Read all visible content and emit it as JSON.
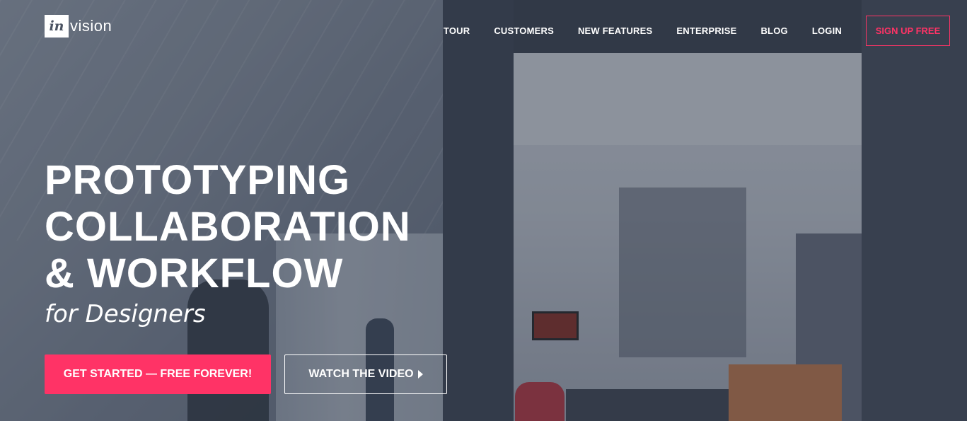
{
  "logo": {
    "mark": "in",
    "text": "vision"
  },
  "nav": {
    "items": [
      "TOUR",
      "CUSTOMERS",
      "NEW FEATURES",
      "ENTERPRISE",
      "BLOG",
      "LOGIN"
    ],
    "signup_label": "SIGN UP FREE"
  },
  "hero": {
    "line1": "PROTOTYPING",
    "line2": "COLLABORATION",
    "line3": "& WORKFLOW",
    "subline": "for Designers",
    "primary_cta": "GET STARTED — FREE FOREVER!",
    "secondary_cta": "WATCH THE VIDEO"
  },
  "colors": {
    "accent": "#ff3366",
    "text": "#ffffff"
  },
  "icons": {
    "play": "play-icon"
  }
}
